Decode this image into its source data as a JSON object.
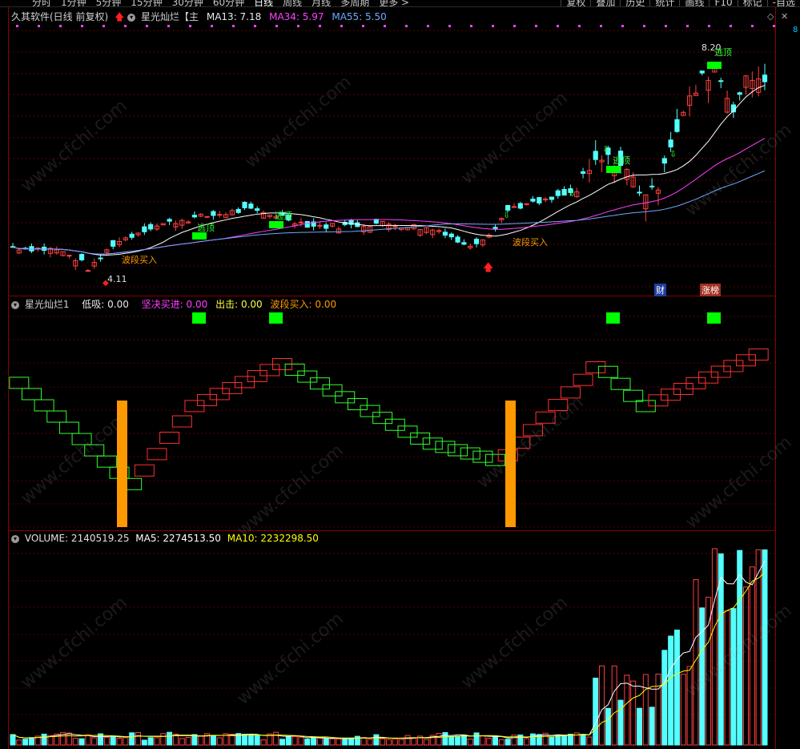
{
  "toolbar": {
    "period_tabs": [
      "分时",
      "1分钟",
      "5分钟",
      "15分钟",
      "30分钟",
      "60分钟",
      "日线",
      "周线",
      "月线",
      "多周期",
      "更多 >"
    ],
    "active_tab": "日线",
    "buttons": [
      "复权",
      "叠加",
      "历史",
      "统计",
      "画线",
      "F10",
      "标记",
      "-自选"
    ]
  },
  "main_pane": {
    "title": "久其软件(日线 前复权)",
    "indicator_name": "星光灿烂【主",
    "ma13": "MA13: 7.18",
    "ma34": "MA34: 5.97",
    "ma55": "MA55: 5.50",
    "high_label": "8.20",
    "low_label": "4.11",
    "escape_label": "逃顶",
    "wave_buy_label": "波段买入",
    "badge_cai": "财",
    "badge_zhangbang": "涨榜",
    "right_edge_value": "8",
    "colors": {
      "up": "#ff4040",
      "down": "#54ffff",
      "ma13": "#ffffff",
      "ma34": "#ff40ff",
      "ma55": "#6fa8ff",
      "signal": "#00ff00"
    }
  },
  "sub_pane": {
    "name": "星光灿烂1",
    "low_absorb": "低吸: 0.00",
    "firm_buy": "坚决买进: 0.00",
    "exit": "出击: 0.00",
    "wave_buy": "波段买入: 0.00",
    "colors": {
      "rise": "#ff3030",
      "fall": "#30ff30",
      "bar": "#ff9900"
    }
  },
  "volume_pane": {
    "volume": "VOLUME: 2140519.25",
    "ma5": "MA5: 2274513.50",
    "ma10": "MA10: 2232298.50",
    "colors": {
      "ma5": "#ffffff",
      "ma10": "#ffff00"
    }
  },
  "watermark": "www.cfchi.com"
}
